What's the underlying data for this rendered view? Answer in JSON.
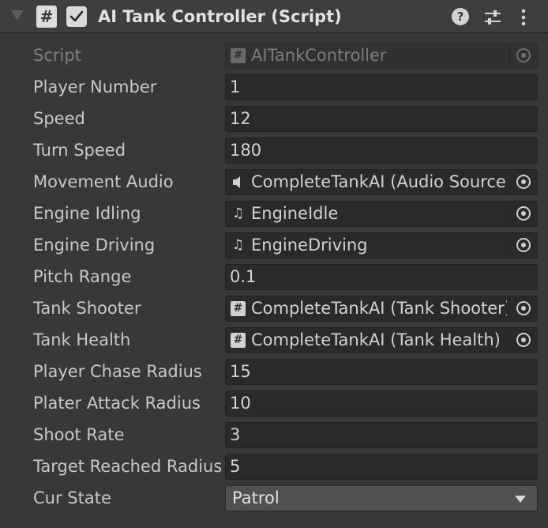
{
  "header": {
    "title": "AI Tank Controller (Script)",
    "enabled": true,
    "icons": {
      "foldout": "foldout-arrow-icon",
      "script": "csharp-script-icon",
      "help": "help-icon",
      "presets": "presets-icon",
      "menu": "kebab-menu-icon"
    }
  },
  "fields": {
    "script": {
      "label": "Script",
      "value": "AITankController"
    },
    "player_number": {
      "label": "Player Number",
      "value": "1"
    },
    "speed": {
      "label": "Speed",
      "value": "12"
    },
    "turn_speed": {
      "label": "Turn Speed",
      "value": "180"
    },
    "movement_audio": {
      "label": "Movement Audio",
      "value": "CompleteTankAI (Audio Source)"
    },
    "engine_idling": {
      "label": "Engine Idling",
      "value": "EngineIdle"
    },
    "engine_driving": {
      "label": "Engine Driving",
      "value": "EngineDriving"
    },
    "pitch_range": {
      "label": "Pitch Range",
      "value": "0.1"
    },
    "tank_shooter": {
      "label": "Tank Shooter",
      "value": "CompleteTankAI (Tank Shooter)"
    },
    "tank_health": {
      "label": "Tank Health",
      "value": "CompleteTankAI (Tank Health)"
    },
    "player_chase_radius": {
      "label": "Player Chase Radius",
      "value": "15"
    },
    "plater_attack_radius": {
      "label": "Plater Attack Radius",
      "value": "10"
    },
    "shoot_rate": {
      "label": "Shoot Rate",
      "value": "3"
    },
    "target_reached_radius": {
      "label": "Target Reached Radius",
      "value": "5"
    },
    "cur_state": {
      "label": "Cur State",
      "value": "Patrol"
    }
  },
  "colors": {
    "panel_bg": "#383838",
    "field_bg": "#2a2a2a",
    "dropdown_bg": "#505050",
    "text": "#d2d2d2",
    "disabled_text": "#7f7f7f"
  }
}
